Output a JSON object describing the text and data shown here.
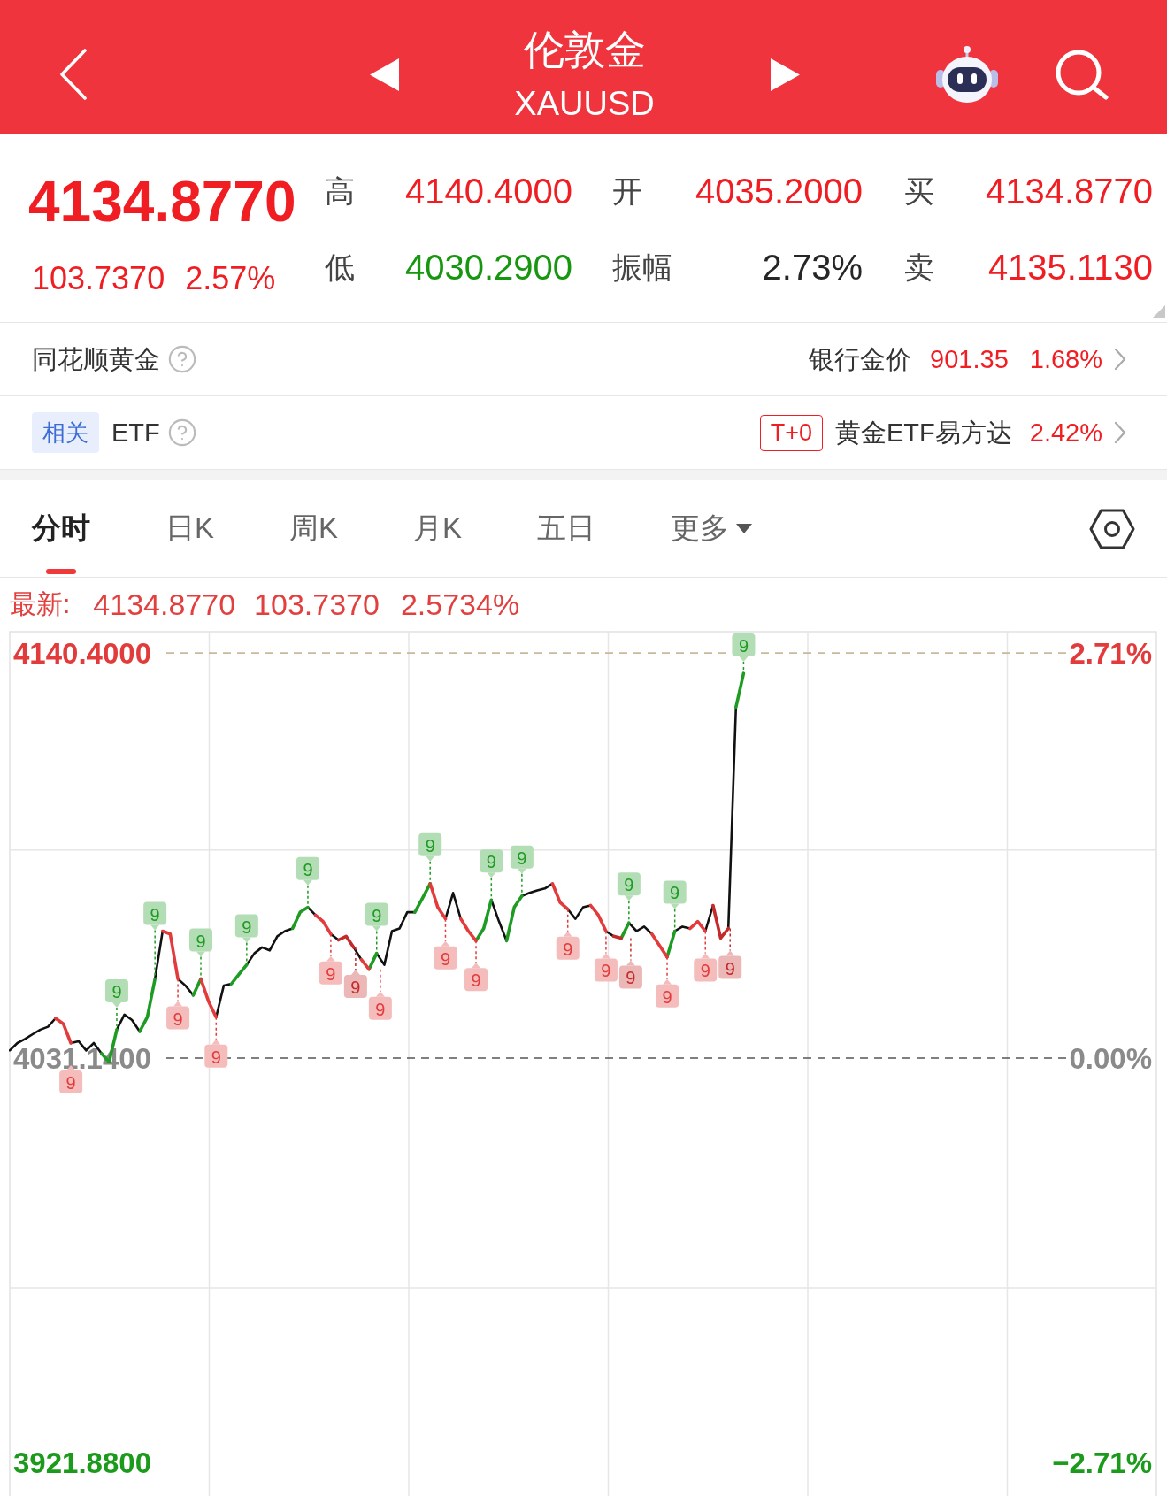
{
  "header": {
    "title": "伦敦金",
    "code": "XAUUSD"
  },
  "quote": {
    "price": "4134.8770",
    "change": "103.7370",
    "change_pct": "2.57%",
    "stats": [
      {
        "label": "高",
        "value": "4140.4000",
        "color": "#f01d22"
      },
      {
        "label": "开",
        "value": "4035.2000",
        "color": "#f01d22"
      },
      {
        "label": "买",
        "value": "4134.8770",
        "color": "#f01d22"
      },
      {
        "label": "低",
        "value": "4030.2900",
        "color": "#17960f"
      },
      {
        "label": "振幅",
        "value": "2.73%",
        "color": "#262626"
      },
      {
        "label": "卖",
        "value": "4135.1130",
        "color": "#f01d22"
      }
    ]
  },
  "gold_row": {
    "title": "同花顺黄金",
    "price_label": "银行金价",
    "price": "901.35",
    "change_pct": "1.68%"
  },
  "etf_row": {
    "tag": "相关",
    "title": "ETF",
    "badge": "T+0",
    "fund": "黄金ETF易方达",
    "change_pct": "2.42%"
  },
  "tabs": [
    {
      "label": "分时",
      "selected": true,
      "kind": "tab"
    },
    {
      "label": "日K",
      "selected": false,
      "kind": "tab"
    },
    {
      "label": "周K",
      "selected": false,
      "kind": "tab"
    },
    {
      "label": "月K",
      "selected": false,
      "kind": "tab"
    },
    {
      "label": "五日",
      "selected": false,
      "kind": "tab"
    },
    {
      "label": "更多",
      "selected": false,
      "kind": "menu"
    }
  ],
  "latest": {
    "label": "最新:",
    "price": "4134.8770",
    "change": "103.7370",
    "change_pct": "2.5734%"
  },
  "chart": {
    "levels": [
      {
        "pct": "2.71%",
        "color": "#e23b3b"
      },
      {
        "pct": "0.00%",
        "color": "#8a8a8a"
      },
      {
        "pct": "−2.71%",
        "color": "#1c9a1c"
      }
    ],
    "chart_data": {
      "type": "line",
      "ylim": [
        3912.8,
        4146.4
      ],
      "yticks": [
        {
          "value": 4140.4,
          "label": "4140.4000"
        },
        {
          "value": 4031.14,
          "label": "4031.1400"
        },
        {
          "value": 3921.88,
          "label": "3921.8800"
        }
      ],
      "ref_lines": [
        {
          "axis": "y",
          "value": 4140.4,
          "color": "#c9b99a"
        },
        {
          "axis": "y",
          "value": 4031.14,
          "color": "#555555"
        }
      ],
      "categories": [
        null,
        null,
        null,
        null,
        null,
        null,
        null,
        null,
        null,
        null,
        null,
        null,
        null,
        null,
        null,
        null,
        null,
        null,
        null,
        null,
        null,
        null,
        null,
        null,
        null,
        null,
        null,
        null,
        null,
        null,
        null,
        null,
        null,
        null,
        null,
        null,
        null,
        null,
        null,
        null,
        null,
        null,
        null,
        null,
        null,
        null,
        null,
        null,
        null,
        null,
        null,
        null,
        null,
        null,
        null,
        null,
        null,
        null,
        null,
        null,
        null,
        null,
        null,
        null,
        null,
        null,
        null,
        null,
        null,
        null,
        null,
        null,
        null,
        null,
        null,
        null,
        null,
        null,
        null,
        null,
        null,
        null,
        null,
        null,
        null,
        null,
        null,
        null,
        null,
        null,
        null,
        null,
        null,
        null,
        null,
        null,
        null,
        null,
        null,
        null,
        null,
        null,
        null,
        null,
        null,
        null,
        null,
        null,
        null,
        null,
        null,
        null,
        null,
        null,
        null,
        null,
        null,
        null,
        null,
        null,
        null,
        null,
        null,
        null,
        null,
        null,
        null,
        null,
        null,
        null,
        null,
        null,
        null,
        null,
        null,
        null,
        null,
        null,
        null,
        null,
        null,
        null,
        null,
        null,
        null,
        null,
        null,
        null,
        null,
        null,
        null
      ],
      "series": [
        {
          "color": "#111111",
          "values": [
            4033.2,
            4035.2,
            4036.3,
            4037.6,
            4038.8,
            4039.6,
            4041.9,
            null,
            4035.2,
            4035.7,
            4033.2,
            4035.2,
            4032.4,
            null,
            4038.8,
            4042.9,
            4041.4,
            4038.3,
            null,
            4052.5,
            4065.4,
            null,
            4052.5,
            4050.7,
            4048.1,
            null,
            null,
            4042.2,
            4050.7,
            4051.2,
            null,
            4056.3,
            4059.4,
            4061.0,
            4060.2,
            4064.0,
            4065.4,
            4066.1,
            null,
            4071.8,
            4069.7,
            null,
            4064.6,
            4063.0,
            null,
            4061.0,
            4057.7,
            null,
            4059.4,
            4056.3,
            4065.4,
            4066.1,
            4070.5,
            4070.5,
            null,
            null,
            null,
            4068.7,
            4075.7,
            4068.7,
            null,
            null,
            null,
            4073.8,
            4068.0,
            4062.8,
            null,
            4074.9,
            4075.7,
            4076.4,
            4076.9,
            4078.2,
            null,
            4071.3,
            4068.7,
            4071.8,
            4072.3,
            null,
            4065.4,
            4064.0,
            null,
            4067.6,
            4065.4,
            4066.6,
            4064.6,
            null,
            null,
            4065.4,
            4066.6,
            4066.1,
            null,
            4065.4,
            4072.3,
            null,
            4066.1,
            4125.8,
            null,
            null,
            null,
            null,
            null,
            null,
            null,
            null,
            null,
            null,
            null,
            null,
            null,
            null,
            null,
            null,
            null,
            null,
            null,
            null,
            null,
            null,
            null,
            null,
            null,
            null,
            null,
            null,
            null,
            null,
            null,
            null,
            null,
            null,
            null,
            null,
            null,
            null,
            null,
            null,
            null,
            null,
            null,
            null,
            null,
            null,
            null,
            null,
            null,
            null,
            null,
            null,
            null,
            null,
            null
          ]
        },
        {
          "color": "#1e9b22",
          "values": [
            null,
            null,
            null,
            null,
            null,
            null,
            null,
            null,
            null,
            null,
            null,
            null,
            4032.4,
            4030.1,
            4038.8,
            null,
            null,
            4038.3,
            4042.2,
            4052.5,
            null,
            null,
            null,
            null,
            4048.1,
            4052.5,
            null,
            null,
            null,
            4051.2,
            4053.8,
            4056.3,
            null,
            null,
            null,
            null,
            null,
            4066.1,
            4070.5,
            4071.8,
            null,
            null,
            null,
            null,
            null,
            null,
            null,
            4055.1,
            4059.4,
            null,
            null,
            null,
            null,
            4070.5,
            4074.3,
            4078.2,
            null,
            null,
            null,
            null,
            null,
            4062.8,
            4066.1,
            4073.8,
            null,
            4062.8,
            4071.8,
            4074.9,
            null,
            null,
            null,
            null,
            null,
            null,
            null,
            null,
            null,
            null,
            null,
            null,
            4063.5,
            4067.6,
            null,
            null,
            null,
            null,
            4058.4,
            4065.4,
            null,
            null,
            null,
            null,
            null,
            null,
            null,
            4125.8,
            4134.9,
            null,
            null,
            null,
            null,
            null,
            null,
            null,
            null,
            null,
            null,
            null,
            null,
            null,
            null,
            null,
            null,
            null,
            null,
            null,
            null,
            null,
            null,
            null,
            null,
            null,
            null,
            null,
            null,
            null,
            null,
            null,
            null,
            null,
            null,
            null,
            null,
            null,
            null,
            null,
            null,
            null,
            null,
            null,
            null,
            null,
            null,
            null,
            null,
            null,
            null,
            null,
            null,
            null,
            null
          ]
        },
        {
          "color": "#e33b3b",
          "values": [
            null,
            null,
            null,
            null,
            null,
            null,
            4041.9,
            4040.4,
            4035.2,
            null,
            null,
            null,
            null,
            null,
            null,
            null,
            null,
            null,
            null,
            null,
            4065.4,
            4064.6,
            4052.5,
            null,
            null,
            4052.5,
            4046.5,
            4042.2,
            null,
            null,
            null,
            null,
            null,
            null,
            null,
            null,
            null,
            null,
            null,
            null,
            4069.7,
            4068.0,
            4064.6,
            null,
            null,
            null,
            4057.7,
            4055.1,
            null,
            null,
            null,
            null,
            null,
            null,
            null,
            4078.2,
            4071.8,
            4068.7,
            null,
            4068.7,
            4065.4,
            4062.8,
            null,
            null,
            null,
            null,
            null,
            null,
            null,
            null,
            null,
            4078.2,
            4073.1,
            4071.3,
            null,
            null,
            4072.3,
            4069.7,
            4065.4,
            null,
            null,
            null,
            null,
            null,
            4064.6,
            4061.5,
            4058.4,
            null,
            null,
            4066.1,
            4068.0,
            4065.4,
            null,
            null,
            null,
            null,
            null,
            null,
            null,
            null,
            null,
            null,
            null,
            null,
            null,
            null,
            null,
            null,
            null,
            null,
            null,
            null,
            null,
            null,
            null,
            null,
            null,
            null,
            null,
            null,
            null,
            null,
            null,
            null,
            null,
            null,
            null,
            null,
            null,
            null,
            null,
            null,
            null,
            null,
            null,
            null,
            null,
            null,
            null,
            null,
            null,
            null,
            null,
            null,
            null,
            null,
            null,
            null,
            null,
            null,
            null
          ]
        },
        {
          "color": "#c42a2a",
          "values": [
            null,
            null,
            null,
            null,
            null,
            null,
            null,
            null,
            null,
            null,
            null,
            null,
            null,
            null,
            null,
            null,
            null,
            null,
            null,
            null,
            null,
            null,
            null,
            null,
            null,
            null,
            null,
            null,
            null,
            null,
            null,
            null,
            null,
            null,
            null,
            null,
            null,
            null,
            null,
            null,
            null,
            null,
            null,
            4063.0,
            4064.0,
            4061.0,
            null,
            null,
            null,
            null,
            null,
            null,
            null,
            null,
            null,
            null,
            null,
            null,
            null,
            null,
            null,
            null,
            null,
            null,
            null,
            null,
            null,
            null,
            null,
            null,
            null,
            null,
            null,
            null,
            null,
            null,
            null,
            null,
            null,
            4064.0,
            4063.5,
            null,
            null,
            null,
            null,
            null,
            null,
            null,
            null,
            null,
            null,
            null,
            4072.3,
            4063.5,
            4066.1,
            null,
            null,
            null,
            null,
            null,
            null,
            null,
            null,
            null,
            null,
            null,
            null,
            null,
            null,
            null,
            null,
            null,
            null,
            null,
            null,
            null,
            null,
            null,
            null,
            null,
            null,
            null,
            null,
            null,
            null,
            null,
            null,
            null,
            null,
            null,
            null,
            null,
            null,
            null,
            null,
            null,
            null,
            null,
            null,
            null,
            null,
            null,
            null,
            null,
            null,
            null,
            null,
            null,
            null,
            null,
            null
          ]
        }
      ],
      "annotations": [
        "9",
        "9",
        "9",
        "9",
        "9",
        "9",
        "9",
        "9",
        "9",
        "9",
        "9",
        "9",
        "9",
        "9",
        "9",
        "9",
        "9",
        "9",
        "9",
        "9",
        "9",
        "9",
        "9",
        "9",
        "9",
        "9"
      ]
    }
  }
}
